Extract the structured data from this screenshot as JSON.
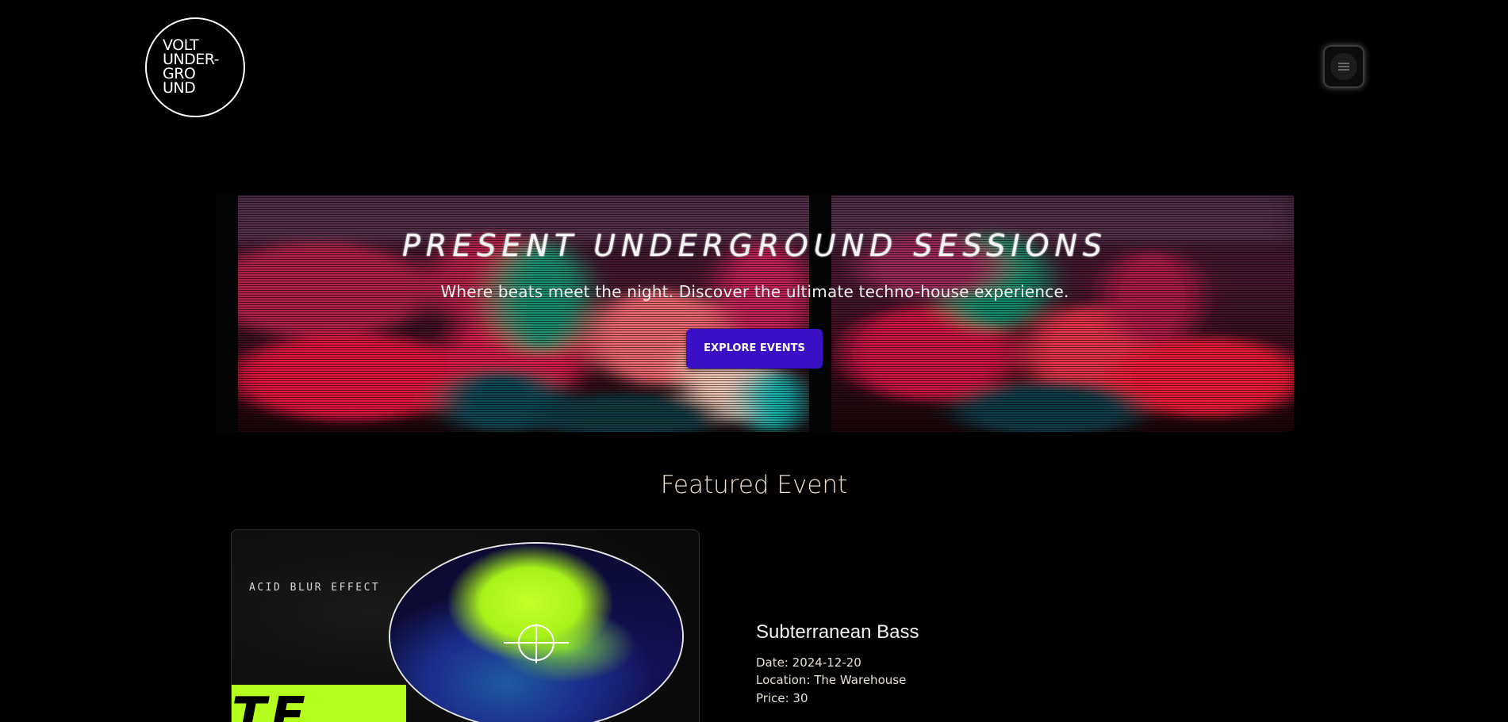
{
  "header": {
    "logo_lines": [
      "VOLT",
      "UNDER-",
      "GRO",
      "UND"
    ],
    "menu_icon": "menu-icon"
  },
  "hero": {
    "title": "PRESENT UNDERGROUND SESSIONS",
    "subtitle": "Where beats meet the night. Discover the ultimate techno-house experience.",
    "cta_label": "EXPLORE EVENTS",
    "colors": {
      "accent_button": "#3a10c4",
      "magenta": "#d4164e",
      "teal": "#17a08a"
    }
  },
  "featured": {
    "section_title": "Featured Event",
    "card": {
      "caption": "ACID BLUR EFFECT",
      "big_text": "T.E",
      "accent_color": "#b4ff1e"
    },
    "event": {
      "name": "Subterranean Bass",
      "date": "Date: 2024-12-20",
      "location": "Location: The Warehouse",
      "price": "Price: 30"
    }
  }
}
